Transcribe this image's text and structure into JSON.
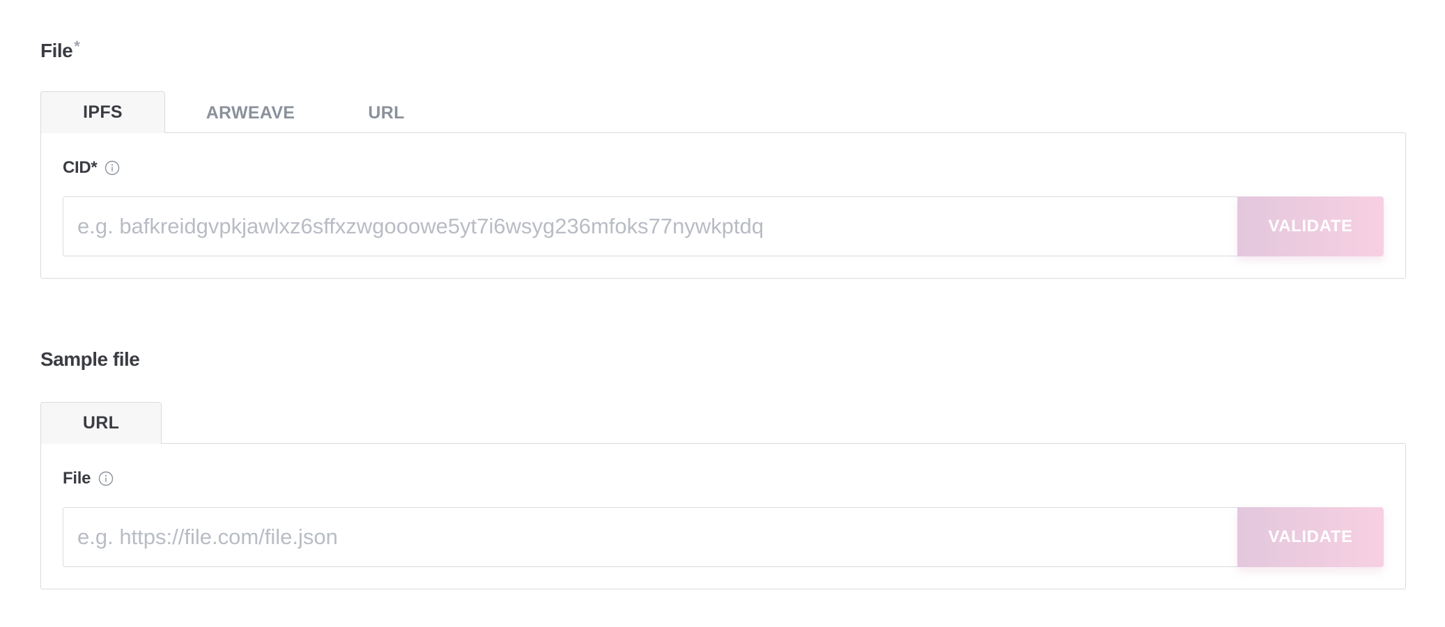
{
  "file_section": {
    "title": "File",
    "required_marker": "*",
    "tabs": [
      {
        "label": "IPFS",
        "active": true
      },
      {
        "label": "ARWEAVE",
        "active": false
      },
      {
        "label": "URL",
        "active": false
      }
    ],
    "field": {
      "label": "CID*",
      "placeholder": "e.g. bafkreidgvpkjawlxz6sffxzwgooowe5yt7i6wsyg236mfoks77nywkptdq",
      "value": "",
      "button_label": "VALIDATE"
    }
  },
  "sample_section": {
    "title": "Sample file",
    "tabs": [
      {
        "label": "URL",
        "active": true
      }
    ],
    "field": {
      "label": "File",
      "placeholder": "e.g. https://file.com/file.json",
      "value": "",
      "button_label": "VALIDATE"
    }
  },
  "colors": {
    "text_primary": "#3a3c42",
    "text_muted": "#8b919b",
    "border": "#d9dbe0",
    "validate_gradient_start": "#e3c7dd",
    "validate_gradient_end": "#f7d0e2"
  },
  "icons": {
    "info": "info-circle-icon"
  }
}
